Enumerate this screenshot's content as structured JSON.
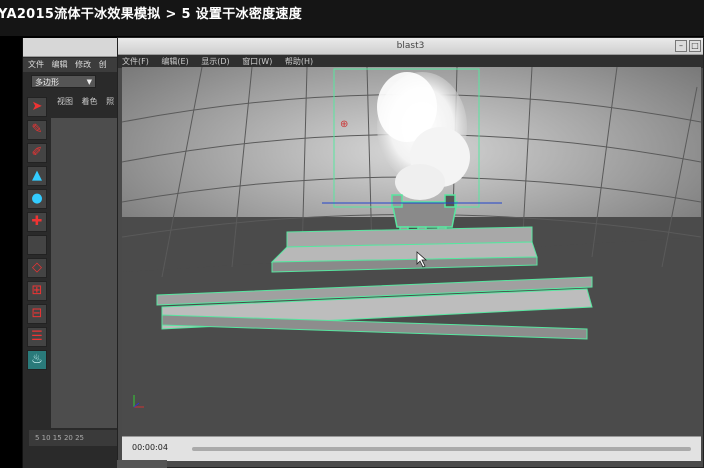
{
  "page": {
    "title": "YA2015流体干冰效果模拟 > 5 设置干冰密度速度"
  },
  "bg_window": {
    "menu": [
      "文件",
      "编辑",
      "修改",
      "创"
    ],
    "dropdown": "多边形",
    "panel_menu": [
      "视图",
      "着色",
      "照"
    ],
    "timeline": "5  10  15  20  25"
  },
  "playblast_window": {
    "title": "blast3",
    "menu": [
      "文件(F)",
      "编辑(E)",
      "显示(D)",
      "窗口(W)",
      "帮助(H)"
    ],
    "timecode": "00:00:04"
  },
  "colors": {
    "accent_green": "#58e6a0",
    "floor": "#4b4b4b",
    "dome": "#8f8f8f"
  }
}
